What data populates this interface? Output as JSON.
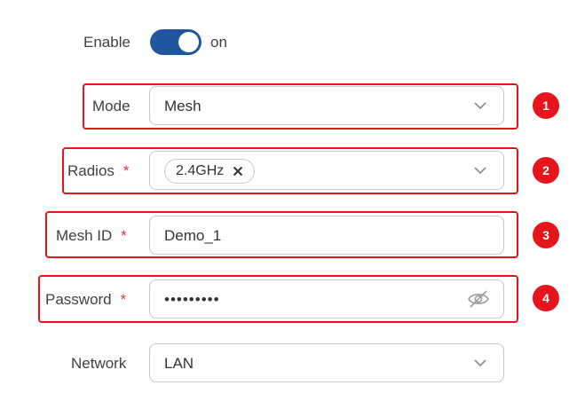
{
  "enable": {
    "label": "Enable",
    "state_text": "on",
    "value": true
  },
  "mode": {
    "label": "Mode",
    "value": "Mesh",
    "marker": "1"
  },
  "radios": {
    "label": "Radios",
    "required_mark": "*",
    "chips": [
      "2.4GHz"
    ],
    "marker": "2"
  },
  "mesh_id": {
    "label": "Mesh ID",
    "required_mark": "*",
    "value": "Demo_1",
    "marker": "3"
  },
  "password": {
    "label": "Password",
    "required_mark": "*",
    "value": "•••••••••",
    "marker": "4"
  },
  "network": {
    "label": "Network",
    "value": "LAN"
  },
  "colors": {
    "accent": "#1e56a0",
    "highlight": "#e8141b",
    "required": "#d9363e"
  },
  "icons": {
    "dropdown": "chevron-down-icon",
    "chip_remove": "close-icon",
    "password_toggle": "eye-off-icon"
  }
}
